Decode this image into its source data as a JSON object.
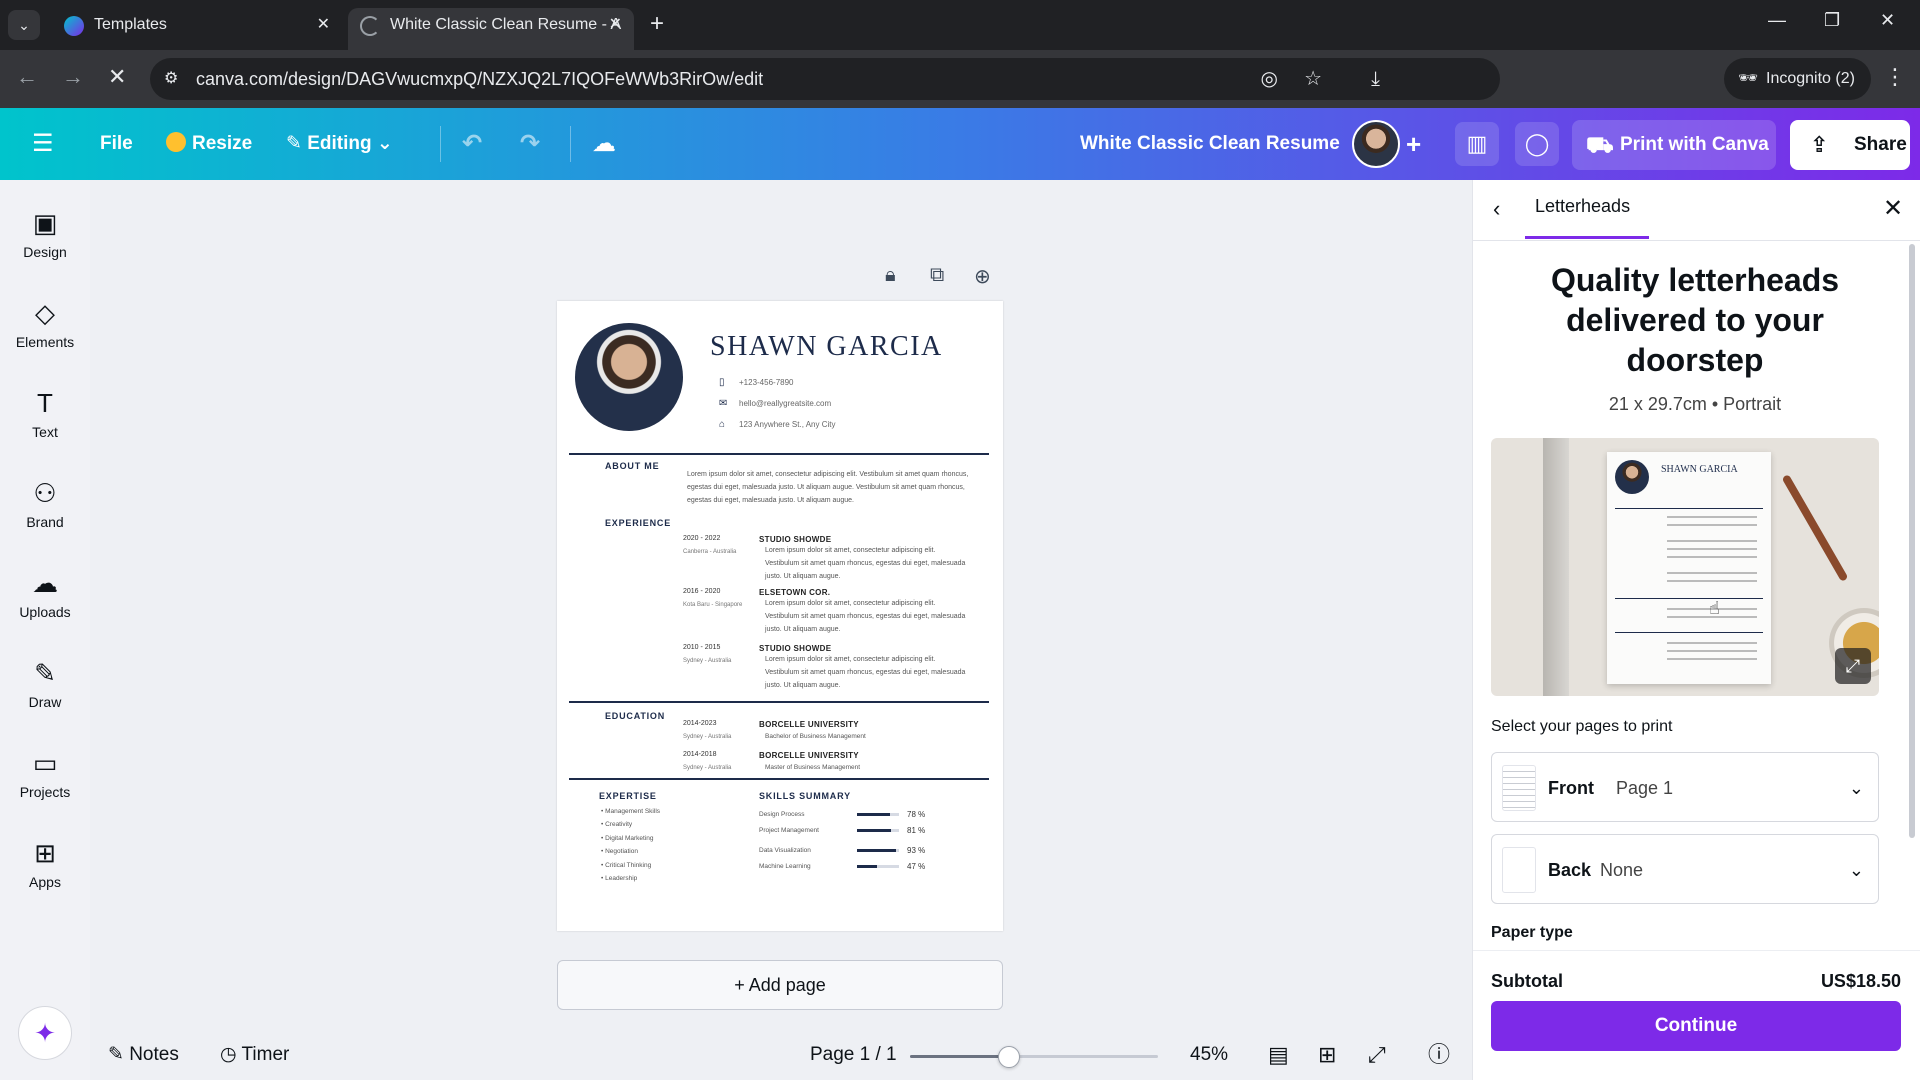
{
  "browser": {
    "tabs": [
      {
        "title": "Templates",
        "active": false
      },
      {
        "title": "White Classic Clean Resume - A",
        "active": true
      }
    ],
    "url": "canva.com/design/DAGVwucmxpQ/NZXJQ2L7IQOFeWWb3RirOw/edit",
    "incognito_label": "Incognito (2)"
  },
  "header": {
    "file_label": "File",
    "resize_label": "Resize",
    "editing_label": "Editing",
    "doc_title": "White Classic Clean Resume",
    "print_label": "Print with Canva",
    "share_label": "Share",
    "brand_gradient": [
      "#00c4cc",
      "#3a7be6",
      "#7d2ae8"
    ]
  },
  "rail": [
    {
      "label": "Design",
      "icon": "design-icon"
    },
    {
      "label": "Elements",
      "icon": "elements-icon"
    },
    {
      "label": "Text",
      "icon": "text-icon"
    },
    {
      "label": "Brand",
      "icon": "brand-icon"
    },
    {
      "label": "Uploads",
      "icon": "uploads-icon"
    },
    {
      "label": "Draw",
      "icon": "draw-icon"
    },
    {
      "label": "Projects",
      "icon": "projects-icon"
    },
    {
      "label": "Apps",
      "icon": "apps-icon"
    }
  ],
  "resume": {
    "name": "SHAWN GARCIA",
    "phone": "+123-456-7890",
    "email": "hello@reallygreatsite.com",
    "address": "123 Anywhere St., Any City",
    "about_heading": "ABOUT ME",
    "about_lines": [
      "Lorem ipsum dolor sit amet, consectetur adipiscing elit. Vestibulum sit amet quam rhoncus,",
      "egestas dui eget, malesuada justo. Ut aliquam augue. Vestibulum sit amet quam rhoncus,",
      "egestas dui eget, malesuada justo. Ut aliquam augue."
    ],
    "experience_heading": "EXPERIENCE",
    "experience": [
      {
        "years": "2020 - 2022",
        "location": "Canberra - Australia",
        "company": "STUDIO SHOWDE"
      },
      {
        "years": "2016 - 2020",
        "location": "Kota Baru - Singapore",
        "company": "ELSETOWN COR."
      },
      {
        "years": "2010 - 2015",
        "location": "Sydney - Australia",
        "company": "STUDIO SHOWDE"
      }
    ],
    "experience_lines": [
      "Lorem ipsum dolor sit amet, consectetur adipiscing elit.",
      "Vestibulum sit amet quam rhoncus, egestas dui eget, malesuada",
      "justo. Ut aliquam augue."
    ],
    "education_heading": "EDUCATION",
    "education": [
      {
        "years": "2014-2023",
        "location": "Sydney - Australia",
        "school": "BORCELLE UNIVERSITY",
        "degree": "Bachelor of Business Management"
      },
      {
        "years": "2014-2018",
        "location": "Sydney - Australia",
        "school": "BORCELLE UNIVERSITY",
        "degree": "Master of Business Management"
      }
    ],
    "expertise_heading": "EXPERTISE",
    "expertise": [
      "Management Skills",
      "Creativity",
      "Digital Marketing",
      "Negotiation",
      "Critical Thinking",
      "Leadership"
    ],
    "skills_heading": "SKILLS SUMMARY",
    "skills": [
      {
        "name": "Design Process",
        "percent": 78,
        "label": "78 %"
      },
      {
        "name": "Project Management",
        "percent": 81,
        "label": "81 %"
      },
      {
        "name": "Data Visualization",
        "percent": 93,
        "label": "93 %"
      },
      {
        "name": "Machine Learning",
        "percent": 47,
        "label": "47 %"
      }
    ]
  },
  "canvas": {
    "add_page_label": "+ Add page"
  },
  "bottom": {
    "notes_label": "Notes",
    "timer_label": "Timer",
    "page_indicator": "Page 1 / 1",
    "zoom_label": "45%",
    "zoom_fraction": 0.4
  },
  "panel": {
    "tab_label": "Letterheads",
    "heading": "Quality letterheads delivered to your doorstep",
    "subheading": "21 x 29.7cm • Portrait",
    "preview_name": "SHAWN GARCIA",
    "select_pages_label": "Select your pages to print",
    "front": {
      "key": "Front",
      "value": "Page 1"
    },
    "back": {
      "key": "Back",
      "value": "None"
    },
    "paper_type_label": "Paper type",
    "subtotal_label": "Subtotal",
    "subtotal_value": "US$18.50",
    "continue_label": "Continue",
    "accent_color": "#7d2ae8"
  }
}
